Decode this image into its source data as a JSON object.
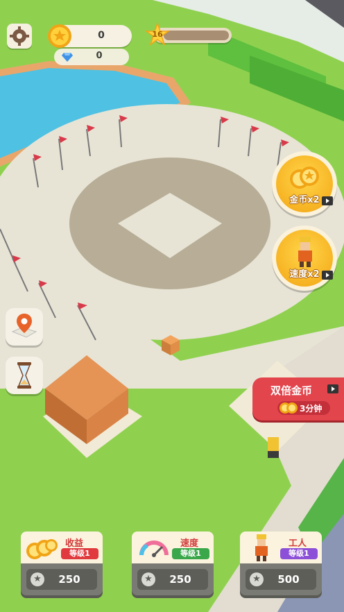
{
  "hud": {
    "gold": "0",
    "gems": "0",
    "level": "16",
    "level_progress": 0
  },
  "boosts": {
    "gold_label": "金币x2",
    "speed_label": "速度x2"
  },
  "double_gold": {
    "title": "双倍金币",
    "duration": "3分钟"
  },
  "upgrades": [
    {
      "title": "收益",
      "level": "等级1",
      "cost": "250",
      "level_color": "#e0393e"
    },
    {
      "title": "速度",
      "level": "等级1",
      "cost": "250",
      "level_color": "#3aa84a"
    },
    {
      "title": "工人",
      "level": "等级1",
      "cost": "500",
      "level_color": "#8c4fd8"
    }
  ],
  "icons": [
    "settings-icon",
    "gold-coin-icon",
    "diamond-icon",
    "level-star-icon",
    "map-pin-icon",
    "hourglass-icon",
    "video-icon"
  ]
}
